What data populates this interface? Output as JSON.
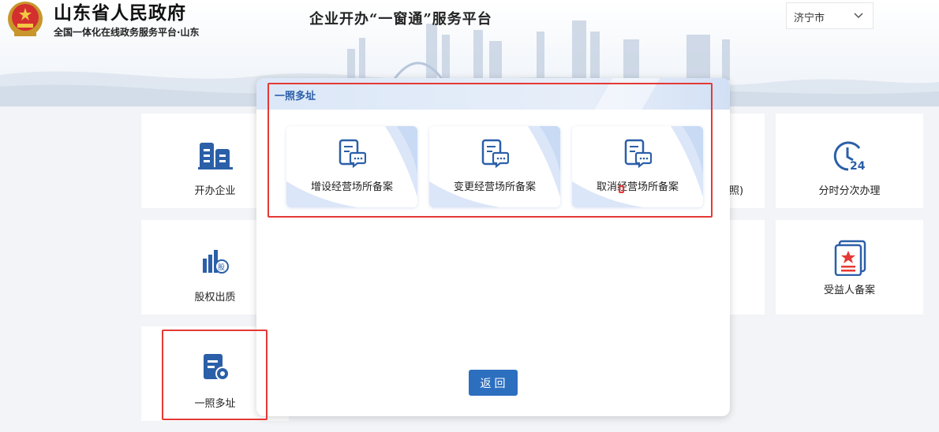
{
  "header": {
    "gov_title": "山东省人民政府",
    "gov_subtitle": "全国一体化在线政务服务平台·山东",
    "platform_title": "企业开办“一窗通”服务平台",
    "city_select": {
      "value": "济宁市"
    }
  },
  "tiles": {
    "kaiban": "开办企业",
    "hidden_partial": "照)",
    "fenshi": "分时分次办理",
    "guquan": "股权出质",
    "shouyiren": "受益人备案",
    "yizhao": "一照多址"
  },
  "modal": {
    "title": "一照多址",
    "cards": [
      {
        "label": "增设经营场所备案"
      },
      {
        "label": "变更经营场所备案"
      },
      {
        "label": "取消经营场所备案"
      }
    ],
    "back_label": "返回"
  },
  "colors": {
    "accent_blue": "#2d6fbf",
    "icon_blue": "#2b5fa8",
    "highlight_red": "#e53935"
  }
}
